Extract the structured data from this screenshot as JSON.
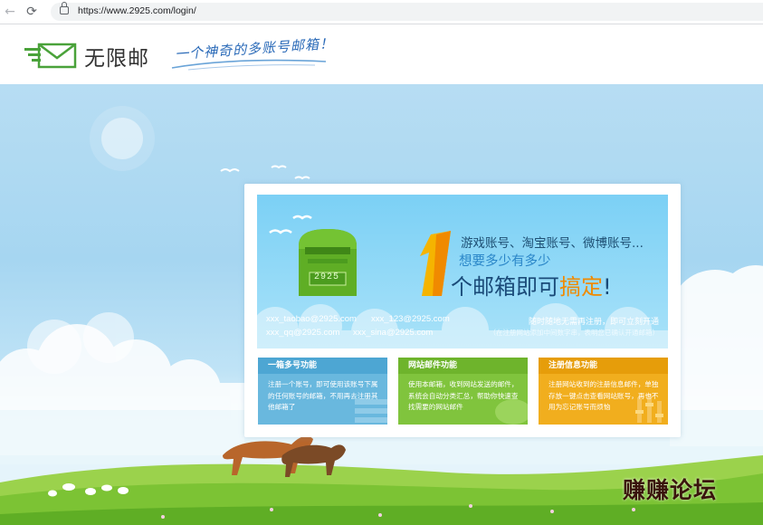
{
  "browser": {
    "url": "https://www.2925.com/login/",
    "back_icon": "arrow-left-icon",
    "reload_icon": "reload-icon",
    "lock_icon": "lock-icon"
  },
  "header": {
    "logo_text": "无限邮",
    "slogan": "一个神奇的多账号邮箱！"
  },
  "banner": {
    "mailbox_number": "2925",
    "big_digit": "1",
    "headline_line1": "游戏账号、淘宝账号、微博账号...",
    "headline_line2": "想要多少有多少",
    "headline_line3_prefix": "个邮箱即可",
    "headline_line3_accent": "搞定",
    "headline_line3_suffix": "!",
    "example_emails": [
      "xxx_taobao@2925.com",
      "xxx_123@2925.com",
      "xxx_qq@2925.com",
      "xxx_sina@2925.com"
    ],
    "note_main": "随时随地无需再注册，即可立刻开通",
    "note_sub": "（在注册网站添加中间数字串，表明您已确认开通邮箱）"
  },
  "features": [
    {
      "title": "一箱多号功能",
      "desc": "注册一个账号，即可使用该账号下属的任何账号的邮箱，不用再去注册其他邮箱了"
    },
    {
      "title": "网站邮件功能",
      "desc": "使用本邮箱，收到网站发送的邮件，系统会自动分类汇总，帮助你快速查找需要的网站邮件"
    },
    {
      "title": "注册信息功能",
      "desc": "注册网站收到的注册信息邮件，单独存放一键点击查看网站账号，再也不用为忘记账号而烦恼"
    }
  ],
  "watermark": "赚赚论坛",
  "colors": {
    "sky": "#a6d6f1",
    "grass": "#7cc334",
    "brand_green": "#4aa23a",
    "accent_orange": "#f08a00",
    "feature_blue": "#69b8de",
    "feature_green": "#80c43d",
    "feature_orange": "#f1ae1e"
  }
}
